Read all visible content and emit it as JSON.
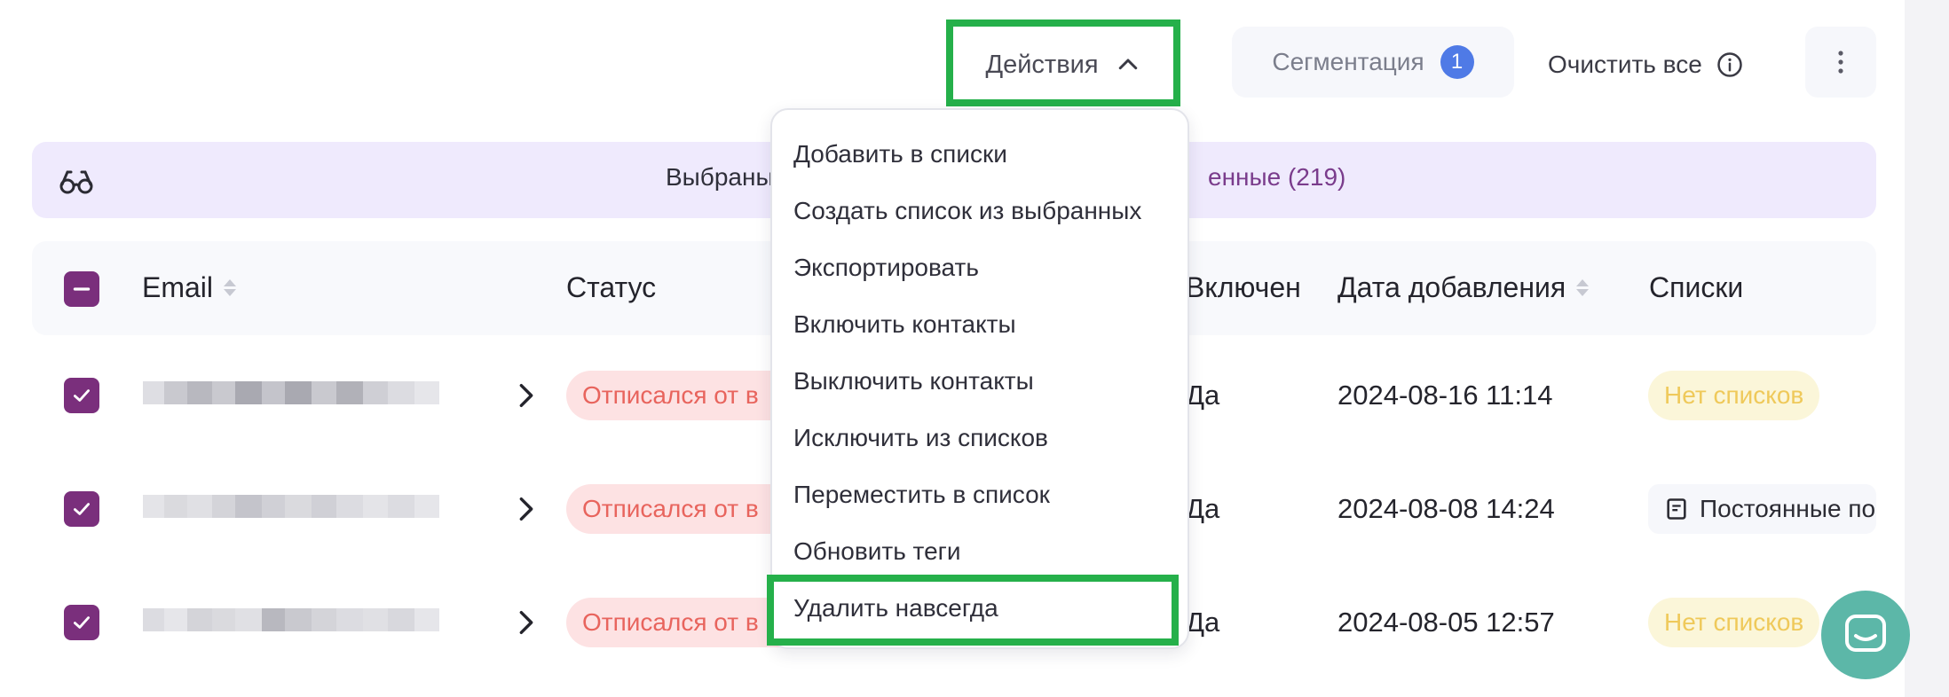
{
  "toolbar": {
    "actions_label": "Действия",
    "segmentation_label": "Сегментация",
    "segmentation_count": "1",
    "clear_all_label": "Очистить все"
  },
  "banner": {
    "text": "Выбраны",
    "count_text": "енные (219)"
  },
  "table": {
    "headers": {
      "email": "Email",
      "status": "Статус",
      "enabled": "Включен",
      "date_added": "Дата добавления",
      "lists": "Списки"
    },
    "rows": [
      {
        "status": "Отписался от в",
        "enabled": "Да",
        "date": "2024-08-16 11:14",
        "lists": "Нет списков",
        "list_kind": "empty"
      },
      {
        "status": "Отписался от в",
        "enabled": "Да",
        "date": "2024-08-08 14:24",
        "lists": "Постоянные по",
        "list_kind": "chip"
      },
      {
        "status": "Отписался от в",
        "enabled": "Да",
        "date": "2024-08-05 12:57",
        "lists": "Нет списков",
        "list_kind": "empty"
      }
    ]
  },
  "menu": {
    "items": [
      "Добавить в списки",
      "Создать список из выбранных",
      "Экспортировать",
      "Включить контакты",
      "Выключить контакты",
      "Исключить из списков",
      "Переместить в список",
      "Обновить теги",
      "Удалить навсегда"
    ]
  },
  "icons": {
    "actions": "chevron-up-icon",
    "clear_all": "info-icon",
    "more": "more-vertical-icon",
    "banner": "glasses-icon",
    "row_expand": "chevron-right-icon",
    "list": "document-icon",
    "chat": "chat-icon"
  },
  "colors": {
    "accent_purple": "#7a2f7c",
    "highlight_green": "#25b04a",
    "status_red": "#e8645d",
    "badge_blue": "#4f7ae6",
    "chat_teal": "#5cb7a8"
  }
}
